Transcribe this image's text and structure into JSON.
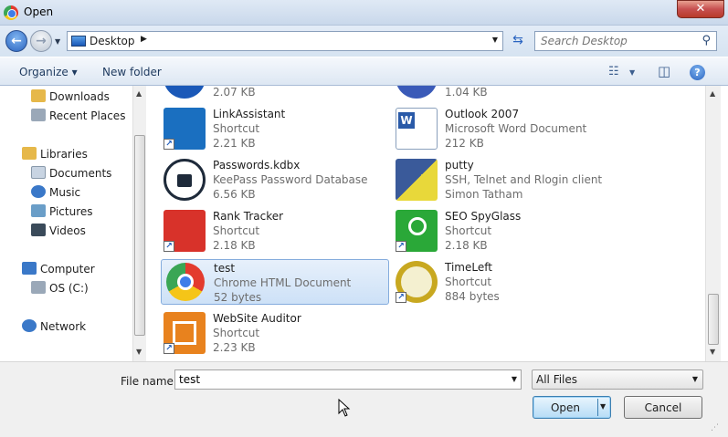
{
  "window": {
    "title": "Open",
    "close_glyph": "✕"
  },
  "address_bar": {
    "back_glyph": "←",
    "forward_glyph": "→",
    "breadcrumb": "Desktop",
    "breadcrumb_arrow": "▶",
    "dropdown_glyph": "▼",
    "refresh_glyph": "⇆",
    "search_placeholder": "Search Desktop",
    "search_glyph": "⚲"
  },
  "toolbar": {
    "organize_label": "Organize ▾",
    "new_folder_label": "New folder",
    "views_glyph": "☷",
    "views_drop_glyph": "▼",
    "preview_glyph": "◫",
    "help_glyph": "?"
  },
  "navigation": {
    "items": [
      {
        "label": "Downloads",
        "icon": "downloads-icon",
        "color": "#e6b84a"
      },
      {
        "label": "Recent Places",
        "icon": "recent-places-icon",
        "color": "#9aa8b8"
      },
      {
        "label": "Libraries",
        "icon": "libraries-icon",
        "color": "#e6b84a"
      },
      {
        "label": "Documents",
        "icon": "documents-icon",
        "color": "#c8d4e2"
      },
      {
        "label": "Music",
        "icon": "music-icon",
        "color": "#3a78c8"
      },
      {
        "label": "Pictures",
        "icon": "pictures-icon",
        "color": "#6a9ec8"
      },
      {
        "label": "Videos",
        "icon": "videos-icon",
        "color": "#3a4a5a"
      },
      {
        "label": "Computer",
        "icon": "computer-icon",
        "color": "#3a78c8"
      },
      {
        "label": "OS (C:)",
        "icon": "drive-icon",
        "color": "#9aa8b8"
      },
      {
        "label": "Network",
        "icon": "network-icon",
        "color": "#3a78c8"
      }
    ]
  },
  "files": {
    "top_cut_left_size": "2.07 KB",
    "top_cut_right_size": "1.04 KB",
    "items": [
      {
        "name": "LinkAssistant",
        "type": "Shortcut",
        "size": "2.21 KB",
        "icon": "linkassistant-icon",
        "color": "#1a6fc0"
      },
      {
        "name": "Outlook 2007",
        "type": "Microsoft Word Document",
        "size": "212 KB",
        "icon": "word-document-icon",
        "color": "#2a5aa8"
      },
      {
        "name": "Passwords.kdbx",
        "type": "KeePass Password Database",
        "size": "6.56 KB",
        "icon": "keepass-lock-icon",
        "color": "#1e2a3a"
      },
      {
        "name": "putty",
        "type": "SSH, Telnet and Rlogin client",
        "size": "Simon Tatham",
        "icon": "putty-icon",
        "color": "#3a5a9a"
      },
      {
        "name": "Rank Tracker",
        "type": "Shortcut",
        "size": "2.18 KB",
        "icon": "rank-tracker-icon",
        "color": "#d8322a"
      },
      {
        "name": "SEO SpyGlass",
        "type": "Shortcut",
        "size": "2.18 KB",
        "icon": "seo-spyglass-icon",
        "color": "#2aa838"
      },
      {
        "name": "test",
        "type": "Chrome HTML Document",
        "size": "52 bytes",
        "icon": "chrome-icon",
        "color": "#3f7de8"
      },
      {
        "name": "TimeLeft",
        "type": "Shortcut",
        "size": "884 bytes",
        "icon": "timeleft-clock-icon",
        "color": "#c8a820"
      },
      {
        "name": "WebSite Auditor",
        "type": "Shortcut",
        "size": "2.23 KB",
        "icon": "website-auditor-icon",
        "color": "#e8821e"
      }
    ],
    "shortcut_glyph": "↗"
  },
  "bottom_bar": {
    "file_name_label": "File name:",
    "file_name_value": "test",
    "filter_value": "All Files",
    "open_label": "Open",
    "cancel_label": "Cancel",
    "dropdown_glyph": "▼"
  }
}
